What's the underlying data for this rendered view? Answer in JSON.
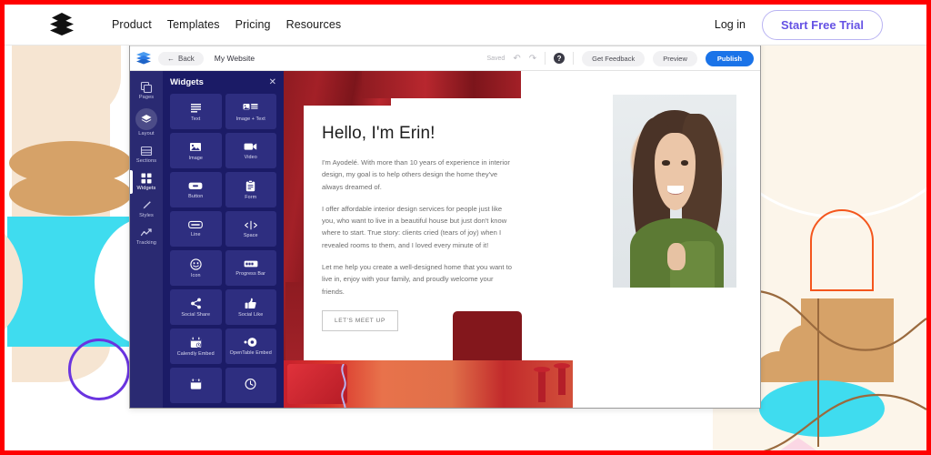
{
  "topnav": {
    "logo_icon": "layers-stack-icon",
    "links": [
      {
        "label": "Product"
      },
      {
        "label": "Templates"
      },
      {
        "label": "Pricing"
      },
      {
        "label": "Resources"
      }
    ],
    "login_label": "Log in",
    "cta_label": "Start Free Trial",
    "cta_color": "#6552E4"
  },
  "browser": {
    "dots": 3
  },
  "editor": {
    "logo_icon": "layers-stack-blue-icon",
    "back_label": "Back",
    "back_icon": "arrow-left-icon",
    "site_title": "My Website",
    "saved_label": "Saved",
    "undo_icon": "undo-icon",
    "redo_icon": "redo-icon",
    "help_icon": "help-question-icon",
    "get_feedback_label": "Get Feedback",
    "preview_label": "Preview",
    "publish_label": "Publish",
    "publish_color": "#1A73E8"
  },
  "rail": {
    "items": [
      {
        "label": "Pages",
        "icon": "pages-icon",
        "active": false,
        "circled": false
      },
      {
        "label": "Layout",
        "icon": "layout-layers-icon",
        "active": false,
        "circled": true
      },
      {
        "label": "Sections",
        "icon": "sections-icon",
        "active": false,
        "circled": false
      },
      {
        "label": "Widgets",
        "icon": "widgets-grid-icon",
        "active": true,
        "circled": false
      },
      {
        "label": "Styles",
        "icon": "brush-icon",
        "active": false,
        "circled": false
      },
      {
        "label": "Tracking",
        "icon": "analytics-icon",
        "active": false,
        "circled": false
      }
    ]
  },
  "widgets_panel": {
    "title": "Widgets",
    "close_icon": "close-icon",
    "items": [
      {
        "label": "Text",
        "icon": "text-lines-icon"
      },
      {
        "label": "Image + Text",
        "icon": "image-text-icon"
      },
      {
        "label": "Image",
        "icon": "image-icon"
      },
      {
        "label": "Video",
        "icon": "video-camera-icon"
      },
      {
        "label": "Button",
        "icon": "button-icon"
      },
      {
        "label": "Form",
        "icon": "clipboard-form-icon"
      },
      {
        "label": "Line",
        "icon": "line-icon"
      },
      {
        "label": "Space",
        "icon": "space-arrows-icon"
      },
      {
        "label": "Icon",
        "icon": "smiley-icon"
      },
      {
        "label": "Progress Bar",
        "icon": "progress-bar-icon"
      },
      {
        "label": "Social Share",
        "icon": "share-icon"
      },
      {
        "label": "Social Like",
        "icon": "thumbs-up-icon"
      },
      {
        "label": "Calendly Embed",
        "icon": "calendar-clock-icon"
      },
      {
        "label": "OpenTable Embed",
        "icon": "opentable-dot-icon"
      },
      {
        "label": "",
        "icon": "calendar-icon"
      },
      {
        "label": "",
        "icon": "clock-icon"
      }
    ]
  },
  "canvas": {
    "heading": "Hello, I'm Erin!",
    "paragraphs": [
      "I'm Ayodelé. With more than 10 years of experience in interior design, my goal is to help others design the home they've always dreamed of.",
      "I offer affordable interior design services for people just like you, who want to live in a beautiful house but just don't know where to start. True story: clients cried (tears of joy) when I revealed rooms to them, and I loved every minute of it!",
      "Let me help you create a well-designed home that you want to live in, enjoy with your family, and proudly welcome your friends."
    ],
    "cta_label": "LET'S MEET UP",
    "photo_alt": "portrait-of-smiling-woman-in-green-top"
  },
  "decorations": {
    "cream": "#F6E5D2",
    "tan": "#D6A268",
    "cyan": "#3FDCEF",
    "purple_circle": "#6A34E0",
    "orange_arch": "#F4561D",
    "brown_line": "#9A6A3E",
    "right_bg": "#FCF5EA",
    "frame": "#FF0000"
  }
}
